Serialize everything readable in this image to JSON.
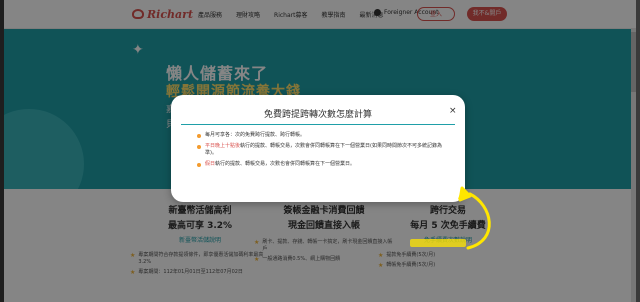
{
  "logo": {
    "text": "Richart"
  },
  "nav": {
    "items": [
      "產品服務",
      "理財攻略",
      "Richart募客",
      "教學指南",
      "最新消息"
    ]
  },
  "foreigner": "Foreigner Account",
  "buttons": {
    "login": "登入",
    "open": "我不&開戶"
  },
  "hero": {
    "line1": "懶人儲蓄來了",
    "line2": "輕鬆開源節流養大錢",
    "line3": "嘉",
    "line4": "貝"
  },
  "cards": [
    {
      "t1": "新臺幣活儲高利",
      "t2": "最高可享 3.2%",
      "t3": "新臺幣活儲說明",
      "bullets": [
        "專案期間符合存款提領條件，即享優惠活儲加碼利率最高 3.2%",
        "專案期間：112年01月01日至112年07月02日"
      ]
    },
    {
      "t1": "簽帳金融卡消費回饋",
      "t2": "現金回饋直接入帳",
      "t3": "",
      "bullets": [
        "刷卡、提款、存錢、轉帳一卡搞定，刷卡現金回饋直接入帳戶",
        "一般通路消費0.5%、網上購物回饋"
      ]
    },
    {
      "t1": "跨行交易",
      "t2": "每月 5 次免手續費",
      "t3": "免手續費次數說明",
      "bullets": [
        "提款免手續費(5次/月)",
        "轉帳免手續費(5次/月)"
      ]
    }
  ],
  "modal": {
    "title": "免費跨提跨轉次數怎麼計算",
    "close": "×",
    "items": [
      {
        "pre": "",
        "em": "",
        "text": "每月可享各：次的免費跨行提款、跨行轉帳。"
      },
      {
        "pre": "",
        "em": "平日晚上十點後",
        "text": "執行的提款、轉帳交易，次數會併同轉帳算在下一個營業日(如果同時間節次不可多統記錄為準)。"
      },
      {
        "pre": "",
        "em": "假日",
        "text": "執行的提款、轉帳交易，次數也會併同轉帳算在下一個營業日。"
      }
    ]
  },
  "colors": {
    "brand": "#d9534f",
    "teal": "#1f9fa8",
    "accent": "#f39b2e",
    "highlight": "#ffe600"
  }
}
